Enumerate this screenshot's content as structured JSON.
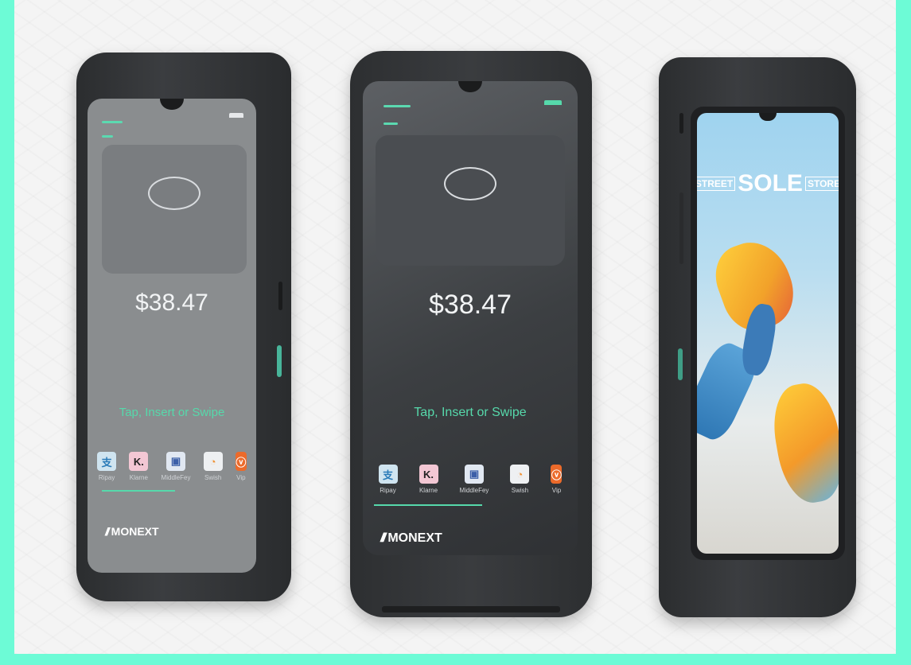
{
  "devices": [
    {
      "amount": "$38.47",
      "prompt": "Tap, Insert or Swipe",
      "brand": "MONEXT",
      "payments": [
        {
          "label": "Ripay",
          "icon": "alipay-icon"
        },
        {
          "label": "Klarne",
          "icon": "klarna-icon"
        },
        {
          "label": "MiddleFey",
          "icon": "middlefey-icon"
        },
        {
          "label": "Swish",
          "icon": "swish-icon"
        },
        {
          "label": "Vip",
          "icon": "vipps-icon"
        }
      ]
    },
    {
      "amount": "$38.47",
      "prompt": "Tap, Insert or Swipe",
      "brand": "MONEXT",
      "payments": [
        {
          "label": "Ripay",
          "icon": "alipay-icon"
        },
        {
          "label": "Klarne",
          "icon": "klarna-icon"
        },
        {
          "label": "MiddleFey",
          "icon": "middlefey-icon"
        },
        {
          "label": "Swish",
          "icon": "swish-icon"
        },
        {
          "label": "Vip",
          "icon": "vipps-icon"
        }
      ]
    }
  ],
  "store_sign": {
    "left": "STREET",
    "middle": "SOLE",
    "right": "STORE"
  },
  "colors": {
    "accent": "#56d9ab",
    "border": "#6dfbd6",
    "device_body": "#2f3133"
  }
}
